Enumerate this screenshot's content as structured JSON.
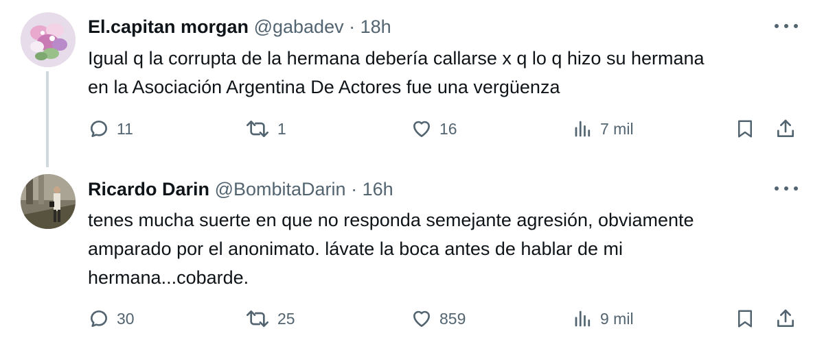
{
  "tweets": [
    {
      "display_name": "El.capitan morgan",
      "handle": "@gabadev",
      "separator": "·",
      "time": "18h",
      "text": "Igual q la corrupta de la hermana debería callarse x q lo q hizo su hermana\nen la Asociación Argentina De Actores fue una vergüenza",
      "replies": "11",
      "retweets": "1",
      "likes": "16",
      "views": "7 mil"
    },
    {
      "display_name": "Ricardo Darin",
      "handle": "@BombitaDarin",
      "separator": "·",
      "time": "16h",
      "text": "tenes mucha suerte en que no responda semejante agresión, obviamente\namparado por el anonimato. lávate la boca antes de hablar de mi\nhermana...cobarde.",
      "replies": "30",
      "retweets": "25",
      "likes": "859",
      "views": "9 mil"
    }
  ],
  "icons": {
    "reply": "reply-icon",
    "retweet": "retweet-icon",
    "like": "heart-icon",
    "views": "views-icon",
    "bookmark": "bookmark-icon",
    "share": "share-icon",
    "more": "more-icon"
  },
  "colors": {
    "text": "#0f1419",
    "secondary": "#536471",
    "thread_line": "#cfd9de"
  }
}
